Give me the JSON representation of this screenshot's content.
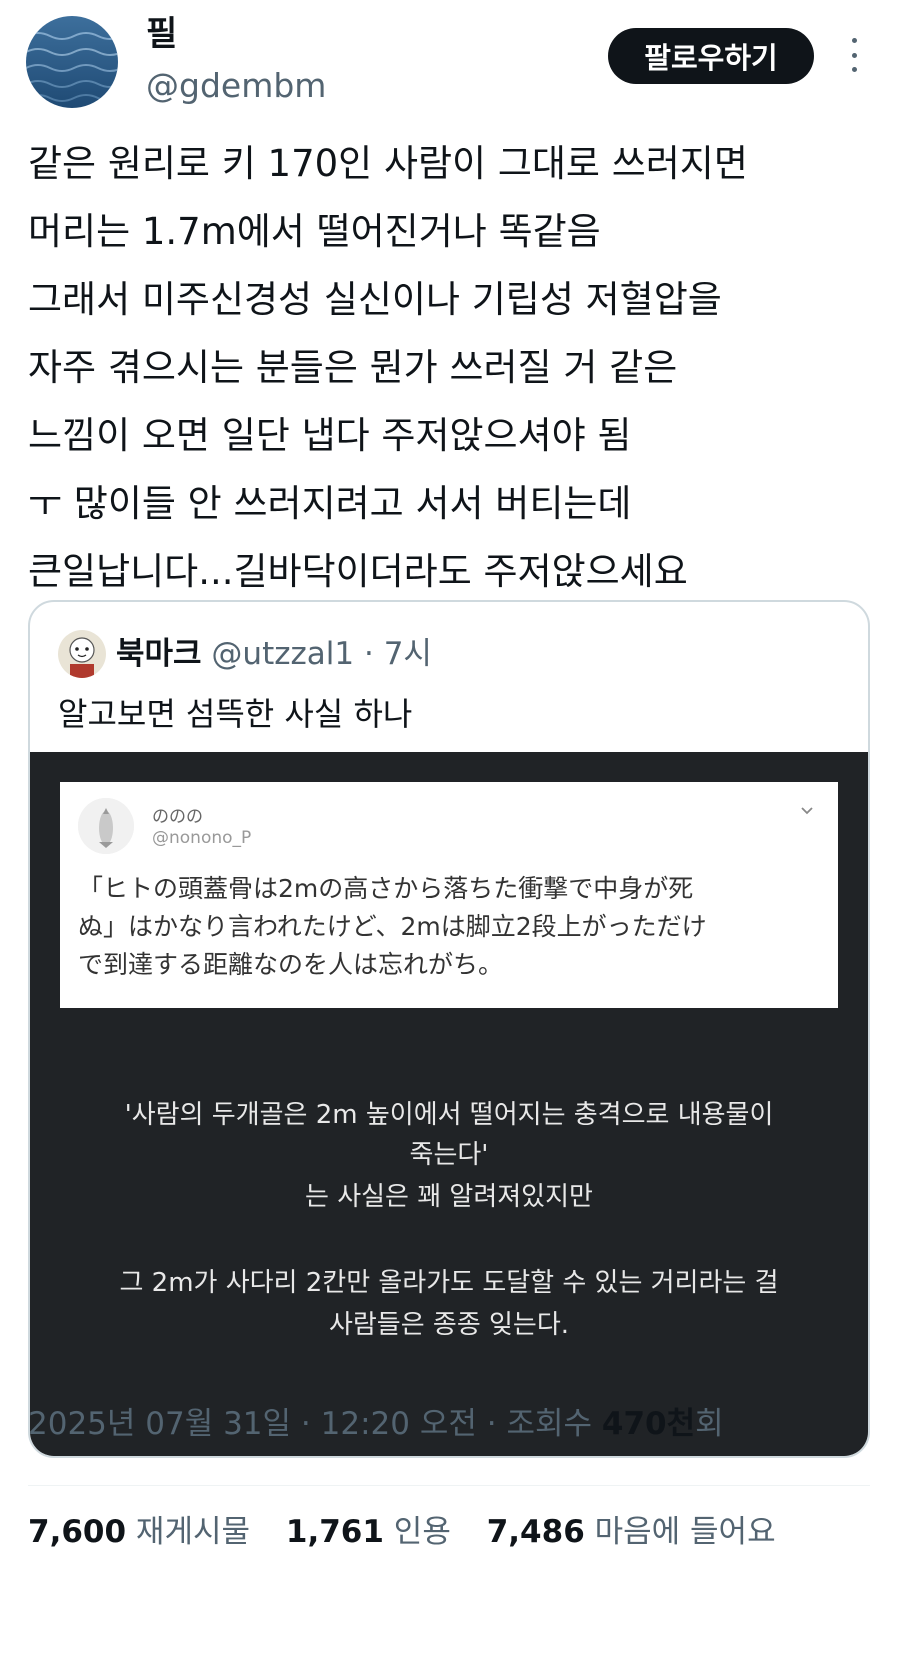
{
  "author": {
    "display_name": "필",
    "handle": "@gdembm",
    "follow_label": "팔로우하기"
  },
  "tweet": {
    "lines": [
      "같은 원리로 키 170인 사람이 그대로 쓰러지면",
      "머리는 1.7m에서 떨어진거나 똑같음",
      "그래서 미주신경성 실신이나 기립성 저혈압을",
      "자주 겪으시는 분들은 뭔가 쓰러질 거 같은",
      "느낌이 오면 일단 냅다 주저앉으셔야 됨",
      "ㅜ 많이들 안 쓰러지려고 서서 버티는데",
      "큰일납니다...길바닥이더라도 주저앉으세요"
    ]
  },
  "quote": {
    "name": "북마크",
    "handle": "@utzzal1",
    "separator": "·",
    "time": "7시",
    "text": "알고보면 섬뜩한 사실 하나",
    "image": {
      "inner_name": "ののの",
      "inner_handle": "@nonono_P",
      "jp_lines": [
        "「ヒトの頭蓋骨は2mの高さから落ちた衝撃で中身が死",
        "ぬ」はかなり言われたけど、2mは脚立2段上がっただけ",
        "で到達する距離なのを人は忘れがち。"
      ],
      "caption_lines": [
        "'사람의 두개골은 2m 높이에서 떨어지는 충격으로 내용물이",
        "죽는다'",
        "는 사실은 꽤 알려져있지만",
        "",
        "그 2m가 사다리 2칸만 올라가도 도달할 수 있는 거리라는 걸",
        "사람들은 종종 잊는다."
      ]
    }
  },
  "meta": {
    "date": "2025년 07월 31일",
    "sep1": "·",
    "time": "12:20 오전",
    "sep2": "·",
    "views_label": "조회수",
    "views_value": "470천",
    "views_suffix": "회"
  },
  "stats": {
    "reposts_value": "7,600",
    "reposts_label": "재게시물",
    "quotes_value": "1,761",
    "quotes_label": "인용",
    "likes_value": "7,486",
    "likes_label": "마음에 들어요"
  },
  "icons": {
    "more": "more-vertical-icon",
    "chevron": "chevron-down-icon"
  }
}
